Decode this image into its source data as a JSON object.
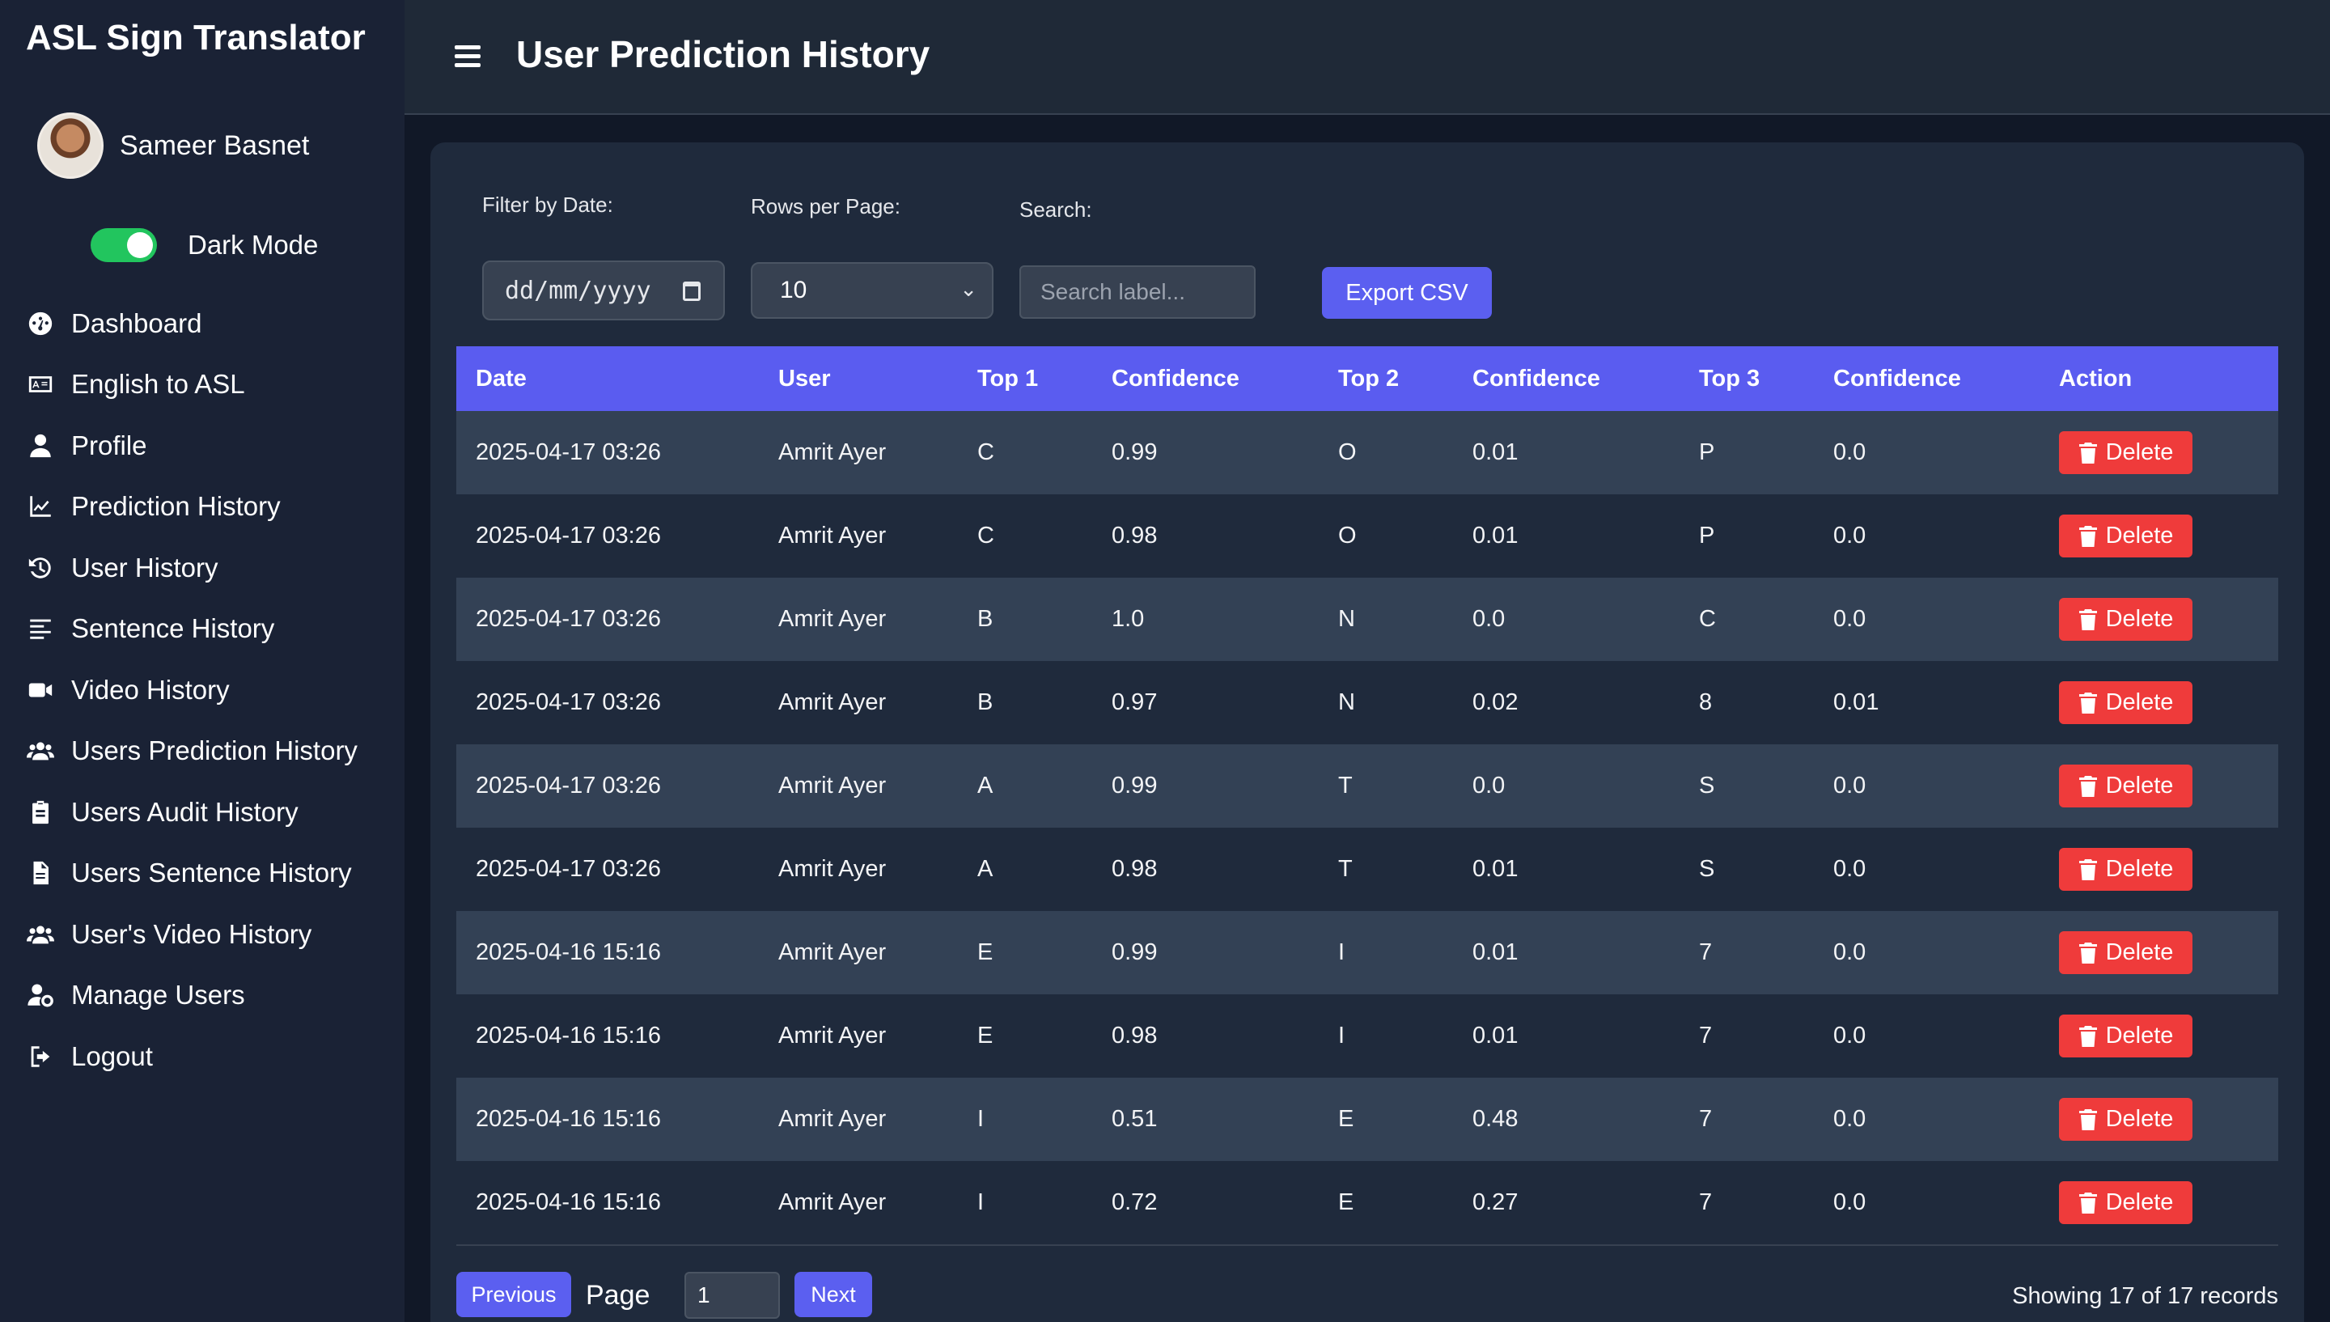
{
  "app": {
    "title": "ASL Sign Translator"
  },
  "user": {
    "name": "Sameer Basnet"
  },
  "dark_mode": {
    "label": "Dark Mode",
    "enabled": true
  },
  "sidebar": {
    "items": [
      {
        "label": "Dashboard",
        "icon": "dashboard-icon"
      },
      {
        "label": "English to ASL",
        "icon": "sign-language-icon"
      },
      {
        "label": "Profile",
        "icon": "user-icon"
      },
      {
        "label": "Prediction History",
        "icon": "chart-line-icon"
      },
      {
        "label": "User History",
        "icon": "history-icon"
      },
      {
        "label": "Sentence History",
        "icon": "align-left-icon"
      },
      {
        "label": "Video History",
        "icon": "video-icon"
      },
      {
        "label": "Users Prediction History",
        "icon": "users-icon"
      },
      {
        "label": "Users Audit History",
        "icon": "clipboard-icon"
      },
      {
        "label": "Users Sentence History",
        "icon": "file-icon"
      },
      {
        "label": "User's Video History",
        "icon": "users-icon"
      },
      {
        "label": "Manage Users",
        "icon": "user-cog-icon"
      },
      {
        "label": "Logout",
        "icon": "logout-icon"
      }
    ]
  },
  "header": {
    "title": "User Prediction History"
  },
  "filters": {
    "date_label": "Filter by Date:",
    "date_placeholder": "dd/mm/yyyy",
    "rows_label": "Rows per Page:",
    "rows_value": "10",
    "search_label": "Search:",
    "search_placeholder": "Search label...",
    "export_label": "Export CSV"
  },
  "table": {
    "headers": [
      "Date",
      "User",
      "Top 1",
      "Confidence",
      "Top 2",
      "Confidence",
      "Top 3",
      "Confidence",
      "Action"
    ],
    "delete_label": "Delete",
    "rows": [
      [
        "2025-04-17 03:26",
        "Amrit Ayer",
        "C",
        "0.99",
        "O",
        "0.01",
        "P",
        "0.0"
      ],
      [
        "2025-04-17 03:26",
        "Amrit Ayer",
        "C",
        "0.98",
        "O",
        "0.01",
        "P",
        "0.0"
      ],
      [
        "2025-04-17 03:26",
        "Amrit Ayer",
        "B",
        "1.0",
        "N",
        "0.0",
        "C",
        "0.0"
      ],
      [
        "2025-04-17 03:26",
        "Amrit Ayer",
        "B",
        "0.97",
        "N",
        "0.02",
        "8",
        "0.01"
      ],
      [
        "2025-04-17 03:26",
        "Amrit Ayer",
        "A",
        "0.99",
        "T",
        "0.0",
        "S",
        "0.0"
      ],
      [
        "2025-04-17 03:26",
        "Amrit Ayer",
        "A",
        "0.98",
        "T",
        "0.01",
        "S",
        "0.0"
      ],
      [
        "2025-04-16 15:16",
        "Amrit Ayer",
        "E",
        "0.99",
        "I",
        "0.01",
        "7",
        "0.0"
      ],
      [
        "2025-04-16 15:16",
        "Amrit Ayer",
        "E",
        "0.98",
        "I",
        "0.01",
        "7",
        "0.0"
      ],
      [
        "2025-04-16 15:16",
        "Amrit Ayer",
        "I",
        "0.51",
        "E",
        "0.48",
        "7",
        "0.0"
      ],
      [
        "2025-04-16 15:16",
        "Amrit Ayer",
        "I",
        "0.72",
        "E",
        "0.27",
        "7",
        "0.0"
      ]
    ]
  },
  "pagination": {
    "previous_label": "Previous",
    "page_label": "Page",
    "page_value": "1",
    "next_label": "Next",
    "records_text": "Showing 17 of 17 records"
  },
  "colors": {
    "accent": "#5b5ff0",
    "danger": "#ef3b3b",
    "toggle_on": "#22c55e",
    "sidebar_bg": "#1a2235",
    "header_bg": "#1f2937"
  }
}
